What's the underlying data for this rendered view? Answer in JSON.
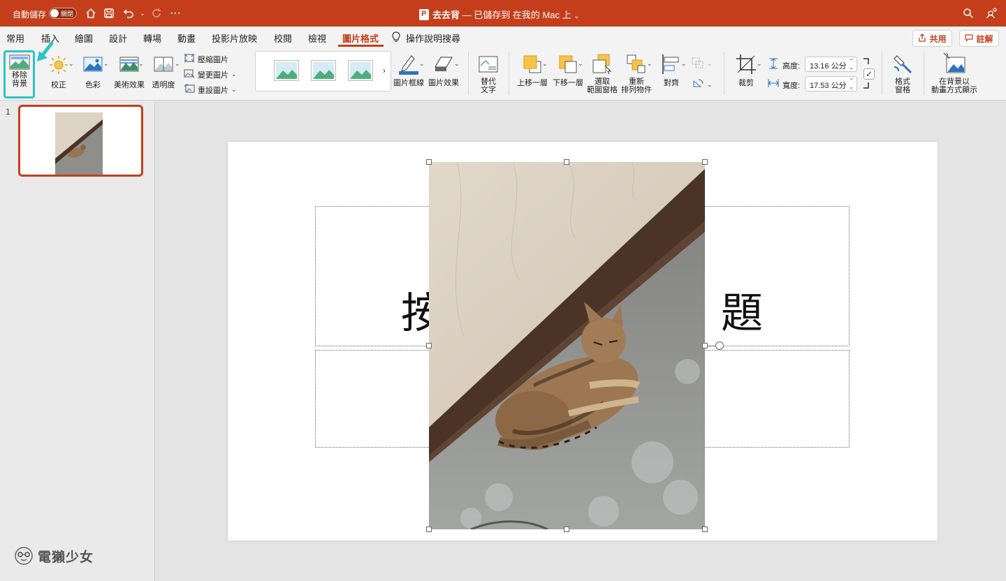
{
  "titlebar": {
    "autosave_label": "自動儲存",
    "autosave_state": "關閉",
    "doc_name": "去去背",
    "doc_status": "— 已儲存到 在我的 Mac 上",
    "icons": [
      "home-icon",
      "save-icon",
      "undo-icon",
      "redo-icon",
      "more-icon",
      "search-icon",
      "share-people-icon"
    ]
  },
  "tabs": [
    "常用",
    "插入",
    "繪圖",
    "設計",
    "轉場",
    "動畫",
    "投影片放映",
    "校閱",
    "檢視",
    "圖片格式"
  ],
  "active_tab": "圖片格式",
  "help_search": "操作說明搜尋",
  "share_label": "共用",
  "comment_label": "註解",
  "ribbon": {
    "remove_bg": [
      "移除",
      "背景"
    ],
    "corrections": "校正",
    "color": "色彩",
    "artistic": "美術效果",
    "transparency": "透明度",
    "compress": "壓縮圖片",
    "change_picture": "變更圖片",
    "reset_picture": "重設圖片",
    "picture_border": "圖片框線",
    "picture_effects": "圖片效果",
    "alt_text": [
      "替代",
      "文字"
    ],
    "bring_forward": "上移一層",
    "send_backward": "下移一層",
    "selection_pane": [
      "選取",
      "範圍窗格"
    ],
    "rearrange": [
      "重新",
      "排列物件"
    ],
    "align": "對齊",
    "crop": "裁剪",
    "height_label": "高度:",
    "height_value": "13.16 公分",
    "width_label": "寬度:",
    "width_value": "17.53 公分",
    "format_pane": [
      "格式",
      "窗格"
    ],
    "animate_bg": [
      "在背景以",
      "動畫方式顯示"
    ]
  },
  "colors": {
    "accent": "#c43e1c",
    "highlight": "#2ec4c4"
  },
  "slides": [
    {
      "number": "1"
    }
  ],
  "slide": {
    "title_visible_left": "按",
    "title_visible_right": "題"
  },
  "watermark": "電獺少女"
}
